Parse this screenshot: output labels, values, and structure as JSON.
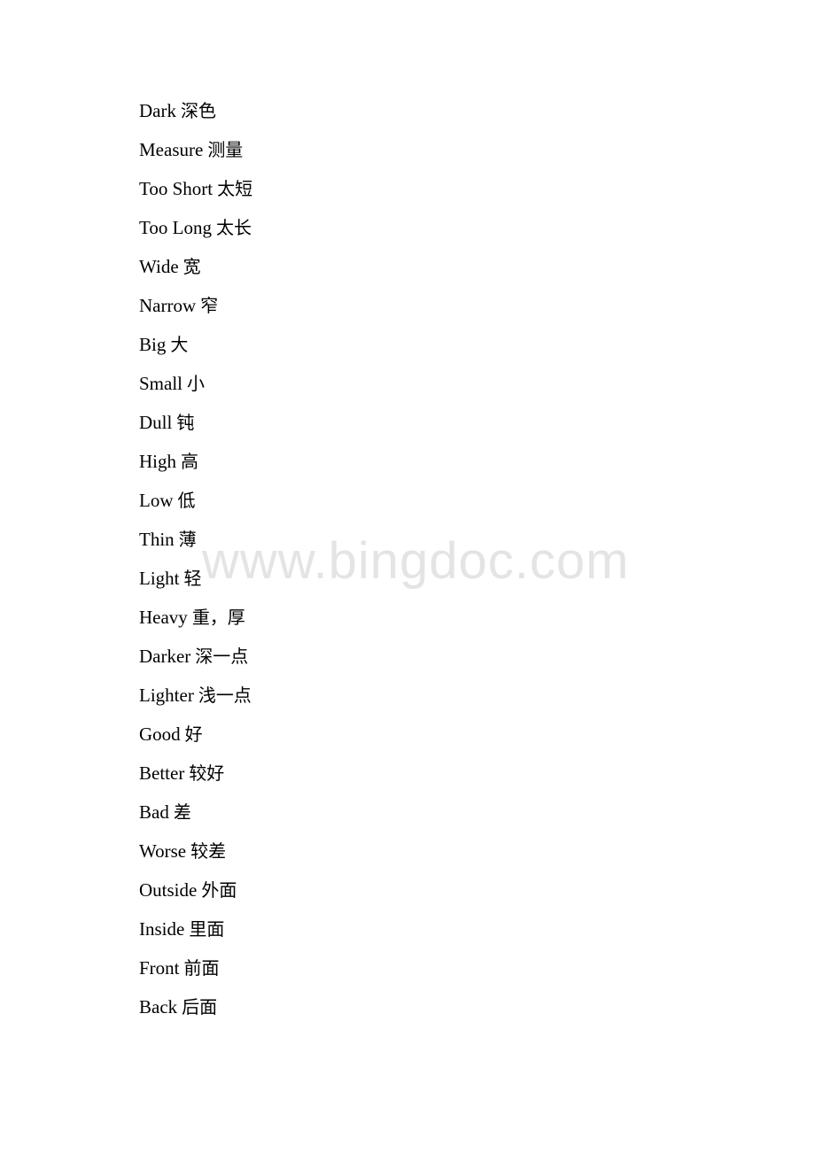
{
  "watermark": "www.bingdoc.com",
  "entries": [
    {
      "en": "Dark",
      "zh": "深色"
    },
    {
      "en": "Measure",
      "zh": "测量"
    },
    {
      "en": "Too Short",
      "zh": "太短"
    },
    {
      "en": "Too Long",
      "zh": "太长"
    },
    {
      "en": "Wide",
      "zh": "宽"
    },
    {
      "en": "Narrow",
      "zh": "窄"
    },
    {
      "en": "Big",
      "zh": "大"
    },
    {
      "en": "Small",
      "zh": "小"
    },
    {
      "en": "Dull",
      "zh": "钝"
    },
    {
      "en": "High",
      "zh": "高"
    },
    {
      "en": "Low",
      "zh": "低"
    },
    {
      "en": "Thin",
      "zh": "薄"
    },
    {
      "en": "Light",
      "zh": "轻"
    },
    {
      "en": "Heavy",
      "zh": "重，厚"
    },
    {
      "en": "Darker",
      "zh": "深一点"
    },
    {
      "en": "Lighter",
      "zh": "浅一点"
    },
    {
      "en": "Good",
      "zh": "好"
    },
    {
      "en": "Better",
      "zh": "较好"
    },
    {
      "en": "Bad",
      "zh": "差"
    },
    {
      "en": "Worse",
      "zh": "较差"
    },
    {
      "en": "Outside",
      "zh": "外面"
    },
    {
      "en": "Inside",
      "zh": "里面"
    },
    {
      "en": "Front",
      "zh": "前面"
    },
    {
      "en": "Back",
      "zh": "后面"
    }
  ]
}
